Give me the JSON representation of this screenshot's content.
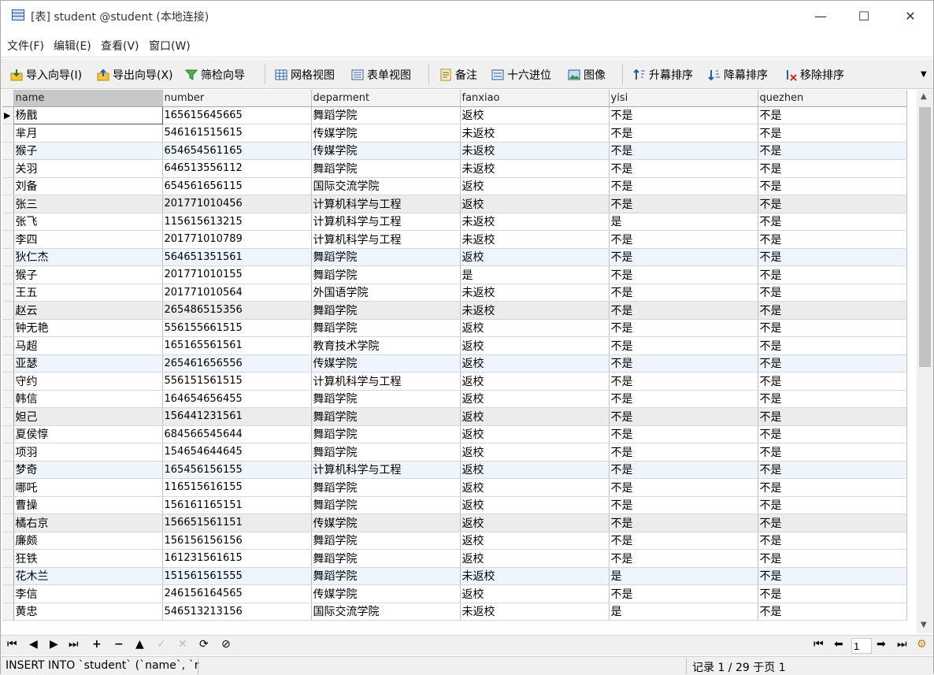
{
  "window": {
    "title": "[表] student @student (本地连接)",
    "minimize": "—",
    "maximize": "☐",
    "close": "✕"
  },
  "menu": [
    "文件(F)",
    "编辑(E)",
    "查看(V)",
    "窗口(W)"
  ],
  "toolbar": {
    "import": "导入向导(I)",
    "export": "导出向导(X)",
    "filter": "筛检向导",
    "grid_view": "网格视图",
    "form_view": "表单视图",
    "memo": "备注",
    "hex": "十六进位",
    "image": "图像",
    "sort_asc": "升幕排序",
    "sort_desc": "降幕排序",
    "remove_sort": "移除排序"
  },
  "table": {
    "columns": [
      "name",
      "number",
      "deparment",
      "fanxiao",
      "yisi",
      "quezhen"
    ],
    "rows": [
      [
        "杨戬",
        "165615645665",
        "舞蹈学院",
        "返校",
        "不是",
        "不是"
      ],
      [
        "芈月",
        "546161515615",
        "传媒学院",
        "未返校",
        "不是",
        "不是"
      ],
      [
        "猴子",
        "654654561165",
        "传媒学院",
        "未返校",
        "不是",
        "不是"
      ],
      [
        "关羽",
        "646513556112",
        "舞蹈学院",
        "未返校",
        "不是",
        "不是"
      ],
      [
        "刘备",
        "654561656115",
        "国际交流学院",
        "返校",
        "不是",
        "不是"
      ],
      [
        "张三",
        "201771010456",
        "计算机科学与工程",
        "返校",
        "不是",
        "不是"
      ],
      [
        "张飞",
        "115615613215",
        "计算机科学与工程",
        "未返校",
        "是",
        "不是"
      ],
      [
        "李四",
        "201771010789",
        "计算机科学与工程",
        "未返校",
        "不是",
        "不是"
      ],
      [
        "狄仁杰",
        "564651351561",
        "舞蹈学院",
        "返校",
        "不是",
        "不是"
      ],
      [
        "猴子",
        "201771010155",
        "舞蹈学院",
        "是",
        "不是",
        "不是"
      ],
      [
        "王五",
        "201771010564",
        "外国语学院",
        "未返校",
        "不是",
        "不是"
      ],
      [
        "赵云",
        "265486515356",
        "舞蹈学院",
        "未返校",
        "不是",
        "不是"
      ],
      [
        "钟无艳",
        "556155661515",
        "舞蹈学院",
        "返校",
        "不是",
        "不是"
      ],
      [
        "马超",
        "165165561561",
        "教育技术学院",
        "返校",
        "不是",
        "不是"
      ],
      [
        "亚瑟",
        "265461656556",
        "传媒学院",
        "返校",
        "不是",
        "不是"
      ],
      [
        "守约",
        "556151561515",
        "计算机科学与工程",
        "返校",
        "不是",
        "不是"
      ],
      [
        "韩信",
        "164654656455",
        "舞蹈学院",
        "返校",
        "不是",
        "不是"
      ],
      [
        "妲己",
        "156441231561",
        "舞蹈学院",
        "返校",
        "不是",
        "不是"
      ],
      [
        "夏侯惇",
        "684566545644",
        "舞蹈学院",
        "返校",
        "不是",
        "不是"
      ],
      [
        "项羽",
        "154654644645",
        "舞蹈学院",
        "返校",
        "不是",
        "不是"
      ],
      [
        "梦奇",
        "165456156155",
        "计算机科学与工程",
        "返校",
        "不是",
        "不是"
      ],
      [
        "哪吒",
        "116515616155",
        "舞蹈学院",
        "返校",
        "不是",
        "不是"
      ],
      [
        "曹操",
        "156161165151",
        "舞蹈学院",
        "返校",
        "不是",
        "不是"
      ],
      [
        "橘右京",
        "156651561151",
        "传媒学院",
        "返校",
        "不是",
        "不是"
      ],
      [
        "廉颇",
        "156156156156",
        "舞蹈学院",
        "返校",
        "不是",
        "不是"
      ],
      [
        "狂铁",
        "161231561615",
        "舞蹈学院",
        "返校",
        "不是",
        "不是"
      ],
      [
        "花木兰",
        "151561561555",
        "舞蹈学院",
        "未返校",
        "是",
        "不是"
      ],
      [
        "李信",
        "246156164565",
        "传媒学院",
        "返校",
        "不是",
        "不是"
      ],
      [
        "黄忠",
        "546513213156",
        "国际交流学院",
        "未返校",
        "是",
        "不是"
      ]
    ]
  },
  "nav": {
    "first": "⏮",
    "prev": "◀",
    "next": "▶",
    "last": "⏭",
    "add": "+",
    "delete": "−",
    "up": "▲",
    "confirm": "✓",
    "cancel": "✕",
    "refresh": "⟳",
    "stop": "⊘",
    "page_value": "1"
  },
  "status": {
    "sql": "INSERT INTO `student` (`name`, `r",
    "record": "记录 1 / 29 于页 1"
  },
  "colors": {
    "alt_row": "#eef5fc",
    "header_selected": "#c8c8c8"
  }
}
